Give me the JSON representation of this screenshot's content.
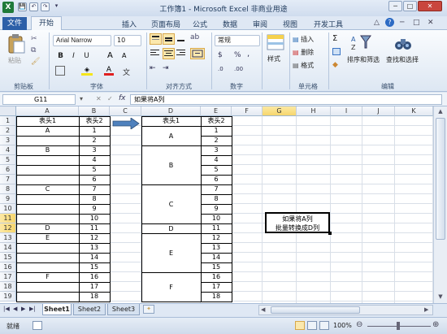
{
  "titlebar": {
    "title": "工作簿1 - Microsoft Excel 非商业用途",
    "qat": [
      "💾",
      "↶",
      "↷",
      "▾"
    ],
    "window_buttons": [
      "─",
      "□",
      "✕"
    ],
    "ribbon_buttons": [
      "△",
      "?",
      "─",
      "□",
      "✕"
    ]
  },
  "tabs": [
    "文件",
    "开始",
    "插入",
    "页面布局",
    "公式",
    "数据",
    "审阅",
    "视图",
    "开发工具"
  ],
  "ribbon": {
    "paste": "粘贴",
    "font_name": "Arial Narrow",
    "font_size": "10",
    "number_format": "常规",
    "styles": "样式",
    "insert": "插入",
    "delete": "删除",
    "format": "格式",
    "sort_filter": "排序和筛选",
    "find_select": "查找和选择",
    "groups": [
      "剪贴板",
      "字体",
      "对齐方式",
      "数字",
      "单元格",
      "编辑"
    ],
    "bold": "B",
    "italic": "I",
    "underline": "U",
    "grow": "A",
    "shrink": "A",
    "currency": "$",
    "percent": "%",
    "comma": ","
  },
  "formula_bar": {
    "name_box": "G11",
    "fx": "fx",
    "formula": "如果将A列"
  },
  "columns": [
    "A",
    "B",
    "C",
    "D",
    "E",
    "F",
    "G",
    "H",
    "I",
    "J",
    "K"
  ],
  "rows": [
    "1",
    "2",
    "3",
    "4",
    "5",
    "6",
    "7",
    "8",
    "9",
    "10",
    "11",
    "12",
    "13",
    "14",
    "15",
    "16",
    "17",
    "18",
    "19"
  ],
  "left_table": {
    "headers": [
      "表头1",
      "表头2"
    ],
    "col_a": [
      {
        "row": 2,
        "text": "A"
      },
      {
        "row": 4,
        "text": "B"
      },
      {
        "row": 8,
        "text": "C"
      },
      {
        "row": 12,
        "text": "D"
      },
      {
        "row": 13,
        "text": "E"
      },
      {
        "row": 17,
        "text": "F"
      }
    ],
    "col_b": [
      "1",
      "2",
      "3",
      "4",
      "5",
      "6",
      "7",
      "8",
      "9",
      "10",
      "11",
      "12",
      "13",
      "14",
      "15",
      "16",
      "17",
      "18"
    ]
  },
  "right_table": {
    "headers": [
      "表头1",
      "表头2"
    ],
    "merged_d": [
      {
        "start": 2,
        "end": 3,
        "text": "A"
      },
      {
        "start": 4,
        "end": 7,
        "text": "B"
      },
      {
        "start": 8,
        "end": 11,
        "text": "C"
      },
      {
        "start": 12,
        "end": 12,
        "text": "D"
      },
      {
        "start": 13,
        "end": 16,
        "text": "E"
      },
      {
        "start": 17,
        "end": 19,
        "text": "F"
      }
    ],
    "col_e": [
      "1",
      "2",
      "3",
      "4",
      "5",
      "6",
      "7",
      "8",
      "9",
      "10",
      "11",
      "12",
      "13",
      "14",
      "15",
      "16",
      "17",
      "18"
    ]
  },
  "note": {
    "line1": "如果将A列",
    "line2": "批量转换成D列"
  },
  "sheets": [
    "Sheet1",
    "Sheet2",
    "Sheet3"
  ],
  "status": {
    "ready": "就绪",
    "zoom": "100%"
  },
  "colors": {
    "accent": "#2c5fa8",
    "selection": "#f6d66d",
    "arrow": "#4f81bd"
  }
}
